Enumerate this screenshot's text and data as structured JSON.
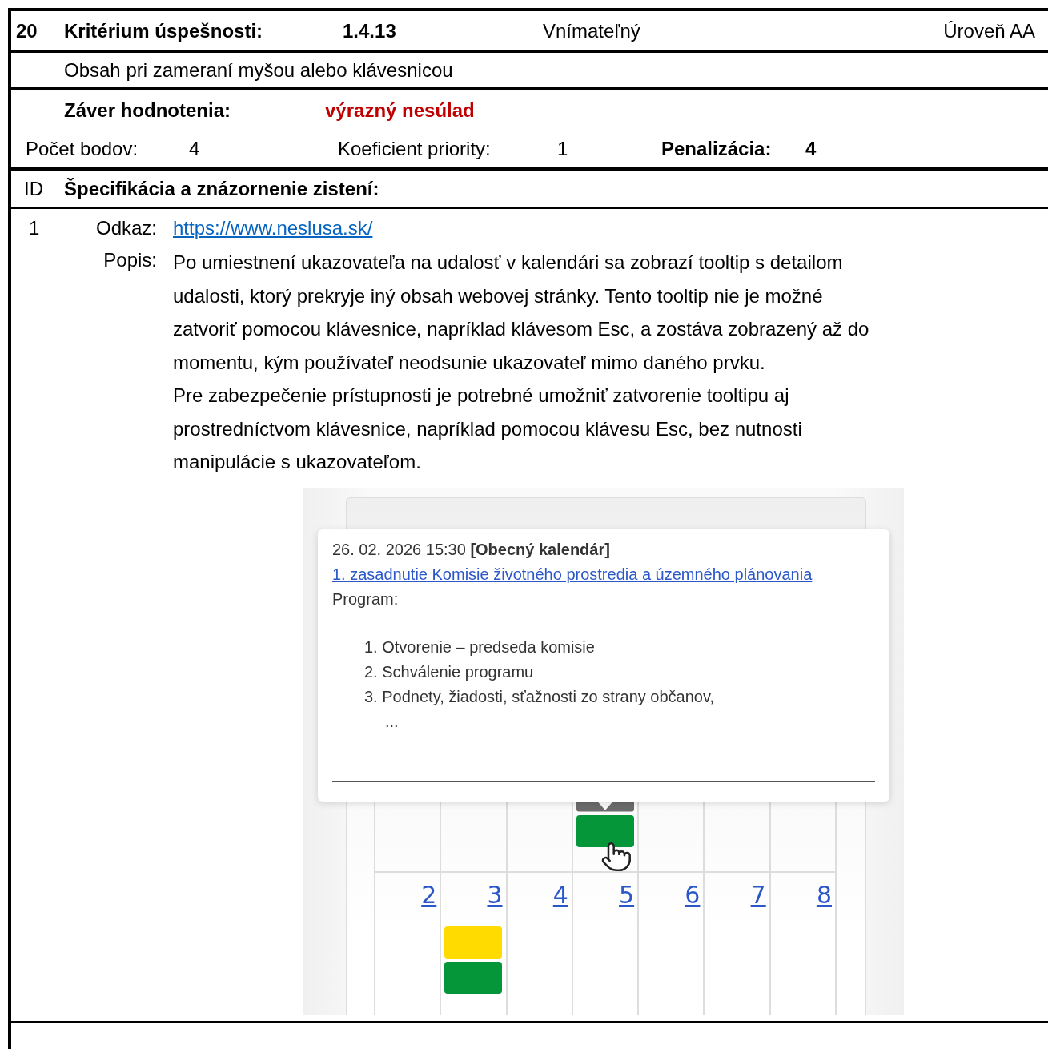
{
  "criterion": {
    "number": "20",
    "label": "Kritérium úspešnosti:",
    "code": "1.4.13",
    "principle": "Vnímateľný",
    "level_text": "Úroveň AA",
    "name": "Obsah pri zameraní myšou alebo klávesnicou"
  },
  "conclusion": {
    "label": "Záver hodnotenia:",
    "value": "výrazný nesúlad"
  },
  "scores": {
    "points_label": "Počet bodov:",
    "points": "4",
    "priority_label": "Koeficient priority:",
    "priority": "1",
    "penalty_label": "Penalizácia:",
    "penalty": "4"
  },
  "findings_header": {
    "id": "ID",
    "title": "Špecifikácia a znázornenie zistení:"
  },
  "findings": [
    {
      "id": "1",
      "link_label": "Odkaz:",
      "link": "https://www.neslusa.sk/",
      "description_label": "Popis:",
      "paragraphs": [
        "Po umiestnení ukazovateľa na udalosť v kalendári sa zobrazí tooltip s detailom udalosti, ktorý prekryje iný obsah webovej stránky. Tento tooltip nie je možné zatvoriť pomocou klávesnice, napríklad klávesom Esc, a zostáva zobrazený až do momentu, kým používateľ neodsunie ukazovateľ mimo daného prvku.",
        "Pre zabezpečenie prístupnosti je potrebné umožniť zatvorenie tooltipu aj prostredníctvom klávesnice, napríklad pomocou klávesu Esc, bez nutnosti manipulácie s ukazovateľom."
      ],
      "screenshot": {
        "tooltip": {
          "datetime": "26. 02. 2026 15:30",
          "calendar": "[Obecný kalendár]",
          "title": "1. zasadnutie Komisie životného prostredia a územného plánovania",
          "program_label": "Program:",
          "items": [
            "1. Otvorenie – predseda komisie",
            "2. Schválenie programu",
            "3. Podnety, žiadosti, sťažnosti zo strany občanov,"
          ],
          "more": "..."
        },
        "weeks": [
          {
            "days": [
              {
                "hovered": false
              },
              {
                "hovered": false
              },
              {
                "hovered": false
              },
              {
                "events": [
                  {
                    "color": "#6b6b6b"
                  },
                  {
                    "color": "#05963a"
                  }
                ],
                "hovered": true
              },
              {
                "hovered": false
              },
              {
                "hovered": false
              },
              {
                "hovered": false
              }
            ]
          },
          {
            "days": [
              {
                "number": "2"
              },
              {
                "number": "3",
                "events": [
                  {
                    "color": "#ffdb00"
                  },
                  {
                    "color": "#05963a"
                  }
                ]
              },
              {
                "number": "4"
              },
              {
                "number": "5"
              },
              {
                "number": "6"
              },
              {
                "number": "7"
              },
              {
                "number": "8"
              }
            ]
          }
        ]
      }
    }
  ]
}
